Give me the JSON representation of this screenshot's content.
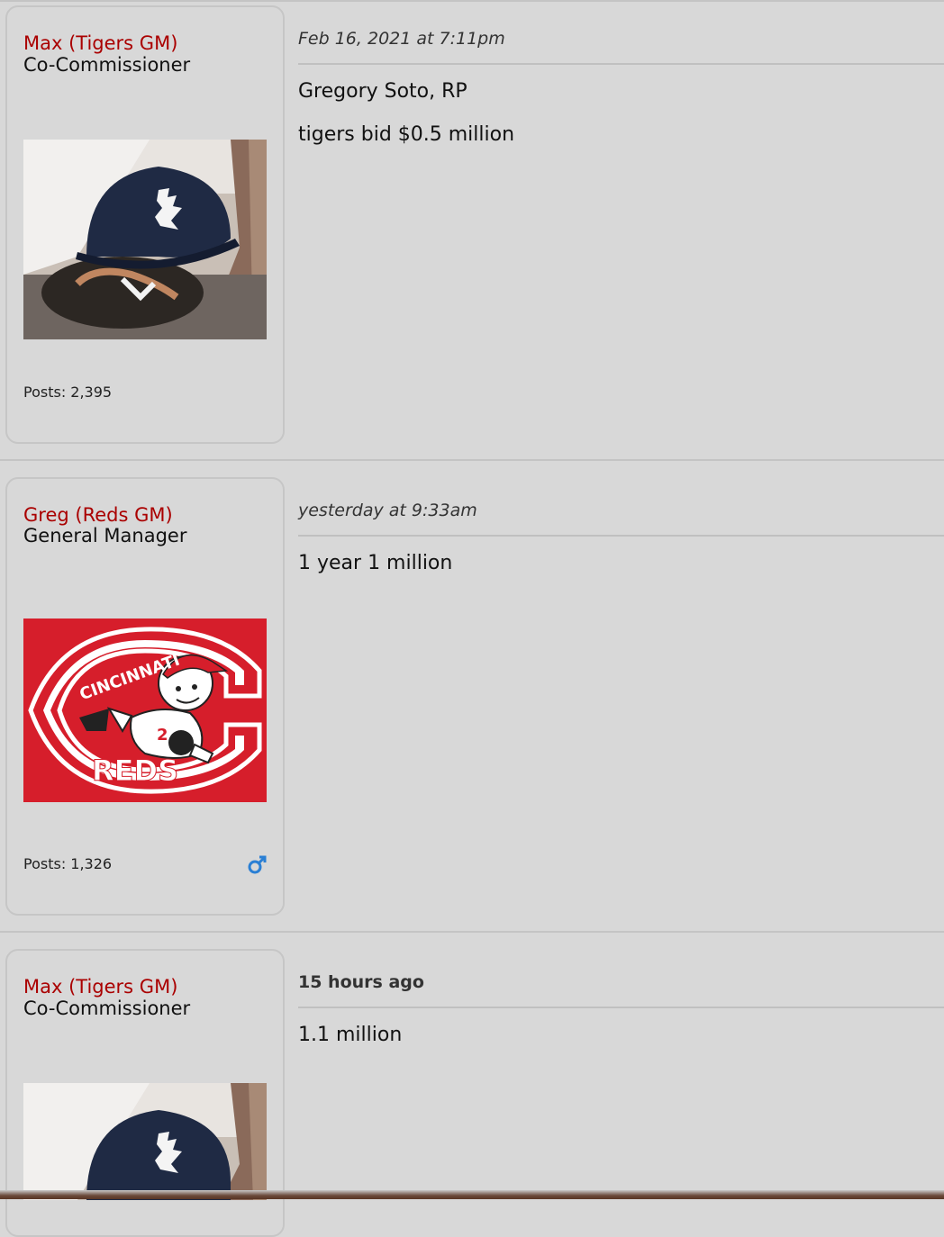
{
  "posts": [
    {
      "username": "Max (Tigers GM)",
      "usertitle": "Co-Commissioner",
      "avatar": "tigers-cap-avatar",
      "posts_count": "Posts: 2,395",
      "date": "Feb 16, 2021 at 7:11pm",
      "message": [
        "Gregory Soto, RP",
        "tigers bid $0.5 million"
      ]
    },
    {
      "username": "Greg (Reds GM)",
      "usertitle": "General Manager",
      "avatar": "cincinnati-reds-logo-avatar",
      "avatar_text": {
        "top": "CINCINNATI",
        "bottom": "REDS"
      },
      "posts_count": "Posts: 1,326",
      "gender_icon": "male-symbol-icon",
      "date": "yesterday at 9:33am",
      "message": [
        "1 year 1 million"
      ]
    },
    {
      "username": "Max (Tigers GM)",
      "usertitle": "Co-Commissioner",
      "avatar": "tigers-cap-avatar",
      "date": "15 hours ago",
      "message": [
        "1.1 million"
      ]
    }
  ],
  "colors": {
    "username": "#aa0000",
    "background": "#d8d8d8",
    "reds_red": "#d61e2b",
    "gender_icon": "#2a7fd4"
  }
}
